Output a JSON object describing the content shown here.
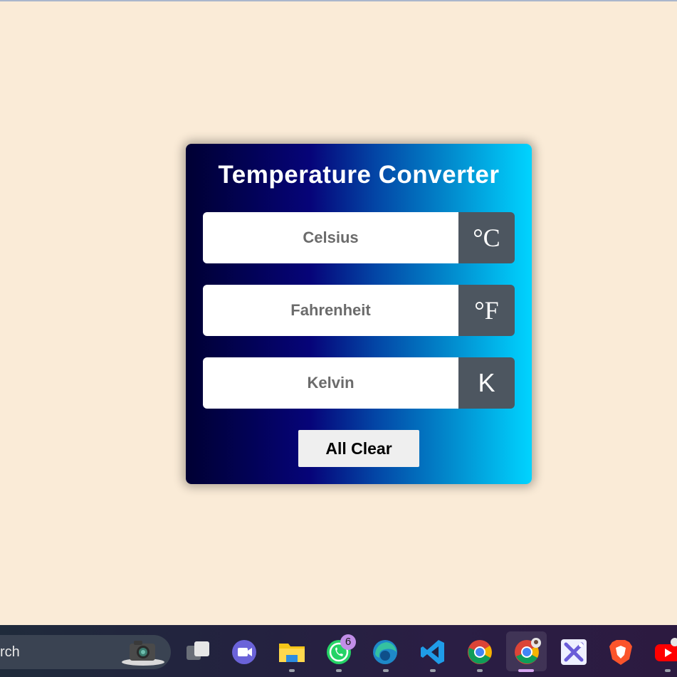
{
  "converter": {
    "title": "Temperature Converter",
    "fields": [
      {
        "placeholder": "Celsius",
        "value": "",
        "unit": "°C"
      },
      {
        "placeholder": "Fahrenheit",
        "value": "",
        "unit": "°F"
      },
      {
        "placeholder": "Kelvin",
        "value": "",
        "unit": "K"
      }
    ],
    "clear_label": "All Clear"
  },
  "taskbar": {
    "search_text": "rch",
    "whatsapp_badge": "6",
    "icons": [
      "camera-icon",
      "task-view-icon",
      "meet-icon",
      "file-explorer-icon",
      "whatsapp-icon",
      "edge-icon",
      "vscode-icon",
      "chrome-icon",
      "chrome-profile-icon",
      "app-icon",
      "brave-icon",
      "youtube-icon"
    ]
  },
  "colors": {
    "page_background": "#faebd7",
    "unit_background": "#4d5660",
    "gradient_start": "#000033",
    "gradient_mid": "#060479",
    "gradient_end": "#00d4ff"
  }
}
